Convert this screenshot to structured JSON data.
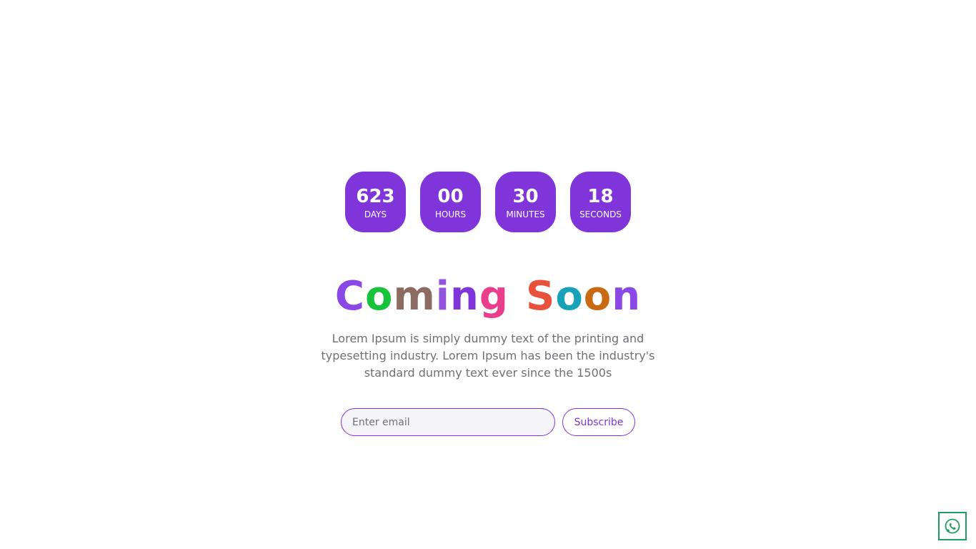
{
  "countdown": [
    {
      "value": "623",
      "label": "DAYS"
    },
    {
      "value": "00",
      "label": "HOURS"
    },
    {
      "value": "30",
      "label": "MINUTES"
    },
    {
      "value": "18",
      "label": "SECONDS"
    }
  ],
  "title": {
    "text": "Coming Soon",
    "letters": [
      {
        "ch": "C",
        "color": "#8a48e6"
      },
      {
        "ch": "o",
        "color": "#16c33b"
      },
      {
        "ch": "m",
        "color": "#8c6c60"
      },
      {
        "ch": "i",
        "color": "#9254de"
      },
      {
        "ch": "n",
        "color": "#7f35d9"
      },
      {
        "ch": "g",
        "color": "#e83e8c"
      },
      {
        "ch": " ",
        "color": "#000000"
      },
      {
        "ch": "S",
        "color": "#e8513b"
      },
      {
        "ch": "o",
        "color": "#17a2b8"
      },
      {
        "ch": "o",
        "color": "#c96a12"
      },
      {
        "ch": "n",
        "color": "#8a48e6"
      }
    ]
  },
  "description": "Lorem Ipsum is simply dummy text of the printing and typesetting industry. Lorem Ipsum has been the industry's standard dummy text ever since the 1500s",
  "form": {
    "email_placeholder": "Enter email",
    "email_value": "",
    "subscribe_label": "Subscribe"
  },
  "whatsapp": {
    "icon": "whatsapp-icon",
    "color": "#1f9d5f"
  },
  "colors": {
    "accent": "#7f35d9",
    "text_muted": "#6f6f78"
  }
}
